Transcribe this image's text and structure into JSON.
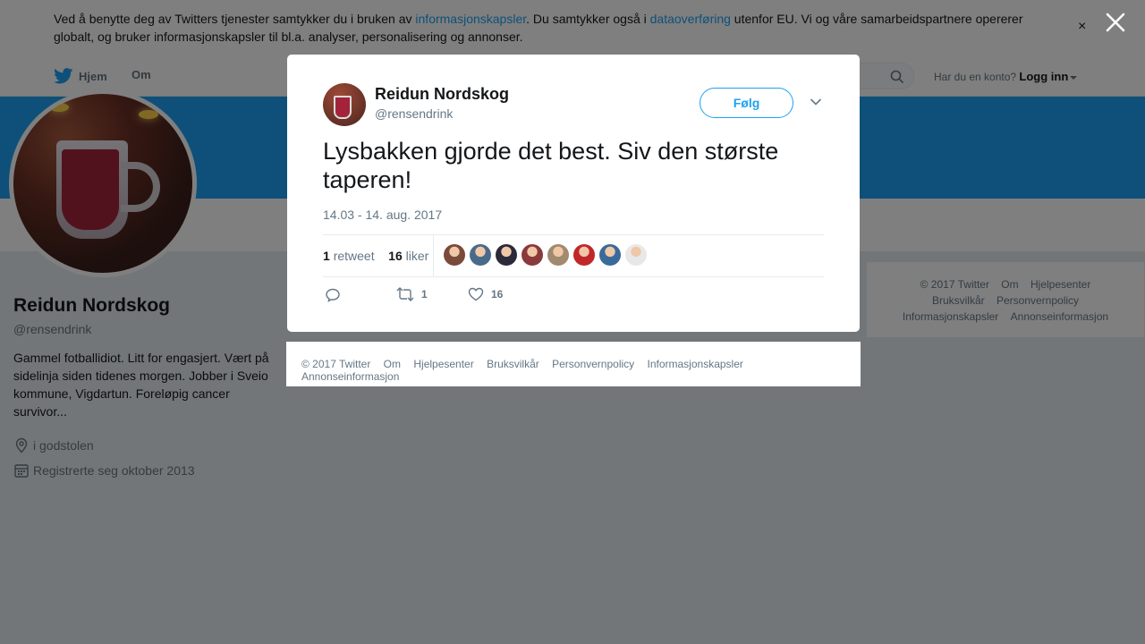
{
  "cookie_banner": {
    "text_1": "Ved å benytte deg av Twitters tjenester samtykker du i bruken av ",
    "link_1": "informasjonskapsler",
    "text_2": ". Du samtykker også i ",
    "link_2": "dataoverføring",
    "text_3": " utenfor EU. Vi og våre samarbeidspartnere opererer globalt, og bruker informasjonskapsler til bl.a. analyser, personalisering og annonser.",
    "dismiss": "×"
  },
  "topnav": {
    "home": "Hjem",
    "about": "Om",
    "account_question": "Har du en konto?",
    "login": "Logg inn"
  },
  "profile": {
    "name": "Reidun Nordskog",
    "handle": "@rensendrink",
    "bio": "Gammel fotballidiot. Litt for engasjert. Vært på sidelinja siden tidenes morgen. Jobber i Sveio kommune, Vigdartun. Foreløpig cancer survivor...",
    "location": "i godstolen",
    "joined": "Registrerte seg oktober 2013"
  },
  "right_footer": {
    "links": [
      "© 2017 Twitter",
      "Om",
      "Hjelpesenter",
      "Bruksvilkår",
      "Personvernpolicy",
      "Informasjonskapsler",
      "Annonseinformasjon"
    ]
  },
  "tweet": {
    "name": "Reidun Nordskog",
    "handle": "@rensendrink",
    "follow": "Følg",
    "text": "Lysbakken gjorde det best. Siv den største taperen!",
    "time": "14.03 - 14. aug. 2017",
    "retweets_count": "1",
    "retweets_label": "retweet",
    "likes_count": "16",
    "likes_label": "liker",
    "action_retweet_count": "1",
    "action_like_count": "16",
    "liker_avatar_colors": [
      "#7a4a3a",
      "#4a6a8a",
      "#2a2a3a",
      "#8a3a3a",
      "#a08a70",
      "#c0282a",
      "#3a6a9a",
      "#e8e8e8"
    ]
  },
  "modal_footer": {
    "links": [
      "© 2017 Twitter",
      "Om",
      "Hjelpesenter",
      "Bruksvilkår",
      "Personvernpolicy",
      "Informasjonskapsler",
      "Annonseinformasjon"
    ]
  },
  "colors": {
    "accent": "#1da1f2",
    "text": "#14171a",
    "muted": "#657786"
  }
}
